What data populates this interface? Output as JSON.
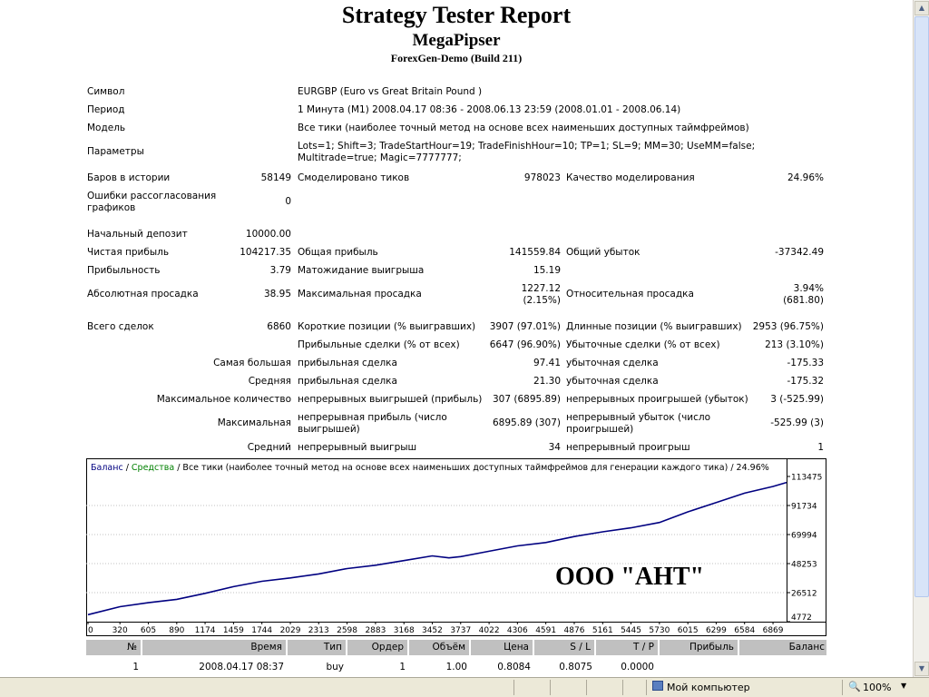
{
  "report": {
    "title": "Strategy Tester Report",
    "expert": "MegaPipser",
    "server": "ForexGen-Demo (Build 211)"
  },
  "info": {
    "symbol_label": "Символ",
    "symbol_value": "EURGBP (Euro vs Great Britain Pound )",
    "period_label": "Период",
    "period_value": "1 Минута (M1) 2008.04.17 08:36 - 2008.06.13 23:59 (2008.01.01 - 2008.06.14)",
    "model_label": "Модель",
    "model_value": "Все тики (наиболее точный метод на основе всех наименьших доступных таймфреймов)",
    "params_label": "Параметры",
    "params_value": "Lots=1; Shift=3; TradeStartHour=19; TradeFinishHour=10; TP=1; SL=9; MM=30; UseMM=false; Multitrade=true; Magic=7777777;"
  },
  "stats": {
    "bars_label": "Баров в истории",
    "bars_value": "58149",
    "ticks_label": "Смоделировано тиков",
    "ticks_value": "978023",
    "quality_label": "Качество моделирования",
    "quality_value": "24.96%",
    "mismatch_label": "Ошибки рассогласования графиков",
    "mismatch_value": "0",
    "deposit_label": "Начальный депозит",
    "deposit_value": "10000.00",
    "netprofit_label": "Чистая прибыль",
    "netprofit_value": "104217.35",
    "grossprofit_label": "Общая прибыль",
    "grossprofit_value": "141559.84",
    "grossloss_label": "Общий убыток",
    "grossloss_value": "-37342.49",
    "pf_label": "Прибыльность",
    "pf_value": "3.79",
    "expected_label": "Матожидание выигрыша",
    "expected_value": "15.19",
    "absdd_label": "Абсолютная просадка",
    "absdd_value": "38.95",
    "maxdd_label": "Максимальная просадка",
    "maxdd_value1": "1227.12",
    "maxdd_value2": "(2.15%)",
    "reldd_label": "Относительная просадка",
    "reldd_value1": "3.94%",
    "reldd_value2": "(681.80)",
    "trades_label": "Всего сделок",
    "trades_value": "6860",
    "short_label": "Короткие позиции (% выигравших)",
    "short_value": "3907 (97.01%)",
    "long_label": "Длинные позиции (% выигравших)",
    "long_value": "2953 (96.75%)",
    "profit_trades_label": "Прибыльные сделки (% от всех)",
    "profit_trades_value": "6647 (96.90%)",
    "loss_trades_label": "Убыточные сделки (% от всех)",
    "loss_trades_value": "213 (3.10%)",
    "largest_label": "Самая большая",
    "largest_profit_label": "прибыльная сделка",
    "largest_profit_value": "97.41",
    "largest_loss_label": "убыточная сделка",
    "largest_loss_value": "-175.33",
    "average_label": "Средняя",
    "average_profit_label": "прибыльная сделка",
    "average_profit_value": "21.30",
    "average_loss_label": "убыточная сделка",
    "average_loss_value": "-175.32",
    "maxcount_label": "Максимальное количество",
    "maxcons_wins_label": "непрерывных выигрышей (прибыль)",
    "maxcons_wins_value": "307 (6895.89)",
    "maxcons_losses_label": "непрерывных проигрышей (убыток)",
    "maxcons_losses_value": "3 (-525.99)",
    "maximal_label": "Максимальная",
    "maxcons_profit_label": "непрерывная прибыль (число выигрышей)",
    "maxcons_profit_value": "6895.89 (307)",
    "maxcons_loss_label": "непрерывный убыток (число проигрышей)",
    "maxcons_loss_value": "-525.99 (3)",
    "avg_label": "Средний",
    "avgcons_wins_label": "непрерывный выигрыш",
    "avgcons_wins_value": "34",
    "avgcons_losses_label": "непрерывный проигрыш",
    "avgcons_losses_value": "1"
  },
  "chart_data": {
    "type": "line",
    "legend_balance": "Баланс",
    "legend_sep": " / ",
    "legend_equity": "Средства",
    "legend_rest": " / Все тики (наиболее точный метод на основе всех наименьших доступных таймфреймов для генерации каждого тика) / 24.96%",
    "colors": {
      "balance": "#000080",
      "equity": "#008000",
      "grid": "#c0c0c0"
    },
    "ylim": [
      4772,
      113475
    ],
    "xlim": [
      0,
      7005
    ],
    "yticks": [
      "113475",
      "91734",
      "69994",
      "48253",
      "26512",
      "4772"
    ],
    "xticks": [
      "0",
      "320",
      "605",
      "890",
      "1174",
      "1459",
      "1744",
      "2029",
      "2313",
      "2598",
      "2883",
      "3168",
      "3452",
      "3737",
      "4022",
      "4306",
      "4591",
      "4876",
      "5161",
      "5445",
      "5730",
      "6015",
      "6299",
      "6584",
      "6869"
    ],
    "series": [
      {
        "values": [
          [
            0,
            10000
          ],
          [
            320,
            16000
          ],
          [
            605,
            19000
          ],
          [
            890,
            21500
          ],
          [
            1174,
            26000
          ],
          [
            1459,
            31000
          ],
          [
            1744,
            35000
          ],
          [
            2029,
            37500
          ],
          [
            2313,
            40500
          ],
          [
            2598,
            44500
          ],
          [
            2883,
            47000
          ],
          [
            3168,
            50500
          ],
          [
            3452,
            54000
          ],
          [
            3620,
            52500
          ],
          [
            3737,
            53500
          ],
          [
            4022,
            57500
          ],
          [
            4306,
            61500
          ],
          [
            4591,
            64000
          ],
          [
            4876,
            68500
          ],
          [
            5161,
            72000
          ],
          [
            5445,
            75000
          ],
          [
            5730,
            79000
          ],
          [
            6015,
            87000
          ],
          [
            6299,
            94000
          ],
          [
            6584,
            101000
          ],
          [
            6869,
            106000
          ],
          [
            7005,
            109000
          ]
        ]
      }
    ]
  },
  "watermark_text": "ООО \"АНТ\"",
  "table": {
    "headers": [
      "№",
      "Время",
      "Тип",
      "Ордер",
      "Объём",
      "Цена",
      "S / L",
      "T / P",
      "Прибыль",
      "Баланс"
    ],
    "rows": [
      [
        "1",
        "2008.04.17 08:37",
        "buy",
        "1",
        "1.00",
        "0.8084",
        "0.8075",
        "0.0000",
        "",
        ""
      ]
    ]
  },
  "statusbar": {
    "zone": "Мой компьютер",
    "zoom": "100%"
  }
}
